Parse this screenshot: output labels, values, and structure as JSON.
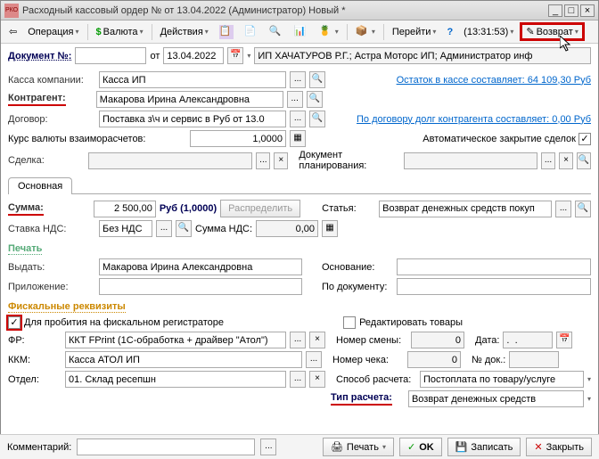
{
  "titlebar": {
    "icon_text": "РКО",
    "title": "Расходный кассовый ордер №  от 13.04.2022 (Администратор) Новый *"
  },
  "toolbar": {
    "operation": "Операция",
    "currency": "Валюта",
    "actions": "Действия",
    "goto": "Перейти",
    "time": "(13:31:53)",
    "return": "Возврат"
  },
  "docnum": {
    "label": "Документ №:",
    "from": "от",
    "date": "13.04.2022",
    "info": "ИП ХАЧАТУРОВ Р.Г.; Астра Моторс ИП; Администратор инф"
  },
  "fields": {
    "kassa_company_label": "Касса компании:",
    "kassa_company": "Касса ИП",
    "balance_link": "Остаток в кассе составляет: 64 109,30 Руб",
    "contragent_label": "Контрагент:",
    "contragent": "Макарова Ирина Александровна",
    "dogovor_label": "Договор:",
    "dogovor": "Поставка з\\ч и сервис в Руб от 13.0",
    "dogovor_debt_link": "По договору долг контрагента составляет: 0,00 Руб",
    "kurs_label": "Курс валюты взаиморасчетов:",
    "kurs": "1,0000",
    "autoclose_label": "Автоматическое закрытие сделок",
    "sdelka_label": "Сделка:",
    "sdelka": "",
    "docplan_label": "Документ планирования:",
    "docplan": ""
  },
  "tabs": {
    "main": "Основная"
  },
  "main_tab": {
    "summa_label": "Сумма:",
    "summa": "2 500,00",
    "summa_cur": "Руб (1,0000)",
    "raspredelit": "Распределить",
    "statya_label": "Статья:",
    "statya": "Возврат денежных средств покуп",
    "stavka_label": "Ставка НДС:",
    "stavka": "Без НДС",
    "summa_nds_label": "Сумма НДС:",
    "summa_nds": "0,00"
  },
  "pechat": {
    "section": "Печать",
    "vydat_label": "Выдать:",
    "vydat": "Макарова Ирина Александровна",
    "osnovanie_label": "Основание:",
    "osnovanie": "",
    "prilozhenie_label": "Приложение:",
    "prilozhenie": "",
    "podokumentu_label": "По документу:",
    "podokumentu": ""
  },
  "fiscal": {
    "section": "Фискальные реквизиты",
    "probitie_label": "Для пробития на фискальном регистраторе",
    "edit_goods_label": "Редактировать товары",
    "fr_label": "ФР:",
    "fr": "ККТ FPrint (1С-обработка + драйвер \"Атол\")",
    "nomer_smeny_label": "Номер смены:",
    "nomer_smeny": "0",
    "data_label": "Дата:",
    "data": ".  .",
    "kkm_label": "ККМ:",
    "kkm": "Касса АТОЛ ИП",
    "nomer_cheka_label": "Номер чека:",
    "nomer_cheka": "0",
    "nomer_dok_label": "№ док.:",
    "nomer_dok": "",
    "otdel_label": "Отдел:",
    "otdel": "01. Склад ресепшн",
    "sposob_label": "Способ расчета:",
    "sposob": "Постоплата по товару/услуге",
    "tip_label": "Тип расчета:",
    "tip": "Возврат денежных средств"
  },
  "footer": {
    "comment_label": "Комментарий:",
    "comment": "",
    "pechat": "Печать",
    "ok": "OK",
    "zapisat": "Записать",
    "zakryt": "Закрыть"
  }
}
